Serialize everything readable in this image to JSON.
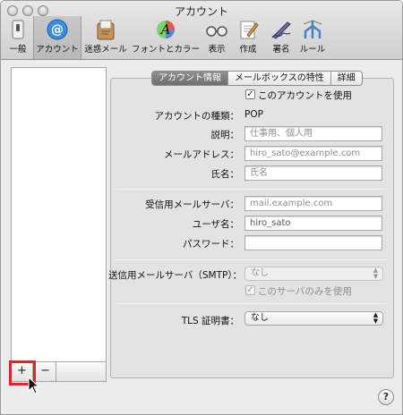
{
  "window": {
    "title": "アカウント"
  },
  "toolbar": [
    {
      "label": "一般",
      "icon": "switch-icon"
    },
    {
      "label": "アカウント",
      "icon": "at-sign-icon"
    },
    {
      "label": "迷惑メール",
      "icon": "junk-mail-icon"
    },
    {
      "label": "フォントとカラー",
      "icon": "fonts-colors-icon"
    },
    {
      "label": "表示",
      "icon": "glasses-icon"
    },
    {
      "label": "作成",
      "icon": "compose-icon"
    },
    {
      "label": "署名",
      "icon": "signature-icon"
    },
    {
      "label": "ルール",
      "icon": "rules-icon"
    }
  ],
  "list": {
    "add_label": "+",
    "remove_label": "−"
  },
  "tabs": [
    {
      "label": "アカウント情報",
      "active": true
    },
    {
      "label": "メールボックスの特性",
      "active": false
    },
    {
      "label": "詳細",
      "active": false
    }
  ],
  "form": {
    "use_account": {
      "label": "このアカウントを使用",
      "checked": true
    },
    "account_type": {
      "label": "アカウントの種類：",
      "value": "POP"
    },
    "description": {
      "label": "説明：",
      "placeholder": "仕事用、個人用"
    },
    "email": {
      "label": "メールアドレス：",
      "placeholder": "hiro_sato@example.com"
    },
    "full_name": {
      "label": "氏名：",
      "placeholder": "氏名"
    },
    "incoming_server": {
      "label": "受信用メールサーバ：",
      "placeholder": "mail.example.com"
    },
    "user_name": {
      "label": "ユーザ名：",
      "value": "hiro_sato"
    },
    "password": {
      "label": "パスワード：",
      "value": ""
    },
    "smtp": {
      "label": "送信用メールサーバ（SMTP）：",
      "value": "なし"
    },
    "only_this_server": {
      "label": "このサーバのみを使用",
      "checked": true
    },
    "tls": {
      "label": "TLS 証明書：",
      "value": "なし"
    }
  },
  "help": {
    "label": "?"
  },
  "colors": {
    "highlight": "#e1242a",
    "selected_tab": "#7c7c7c"
  }
}
